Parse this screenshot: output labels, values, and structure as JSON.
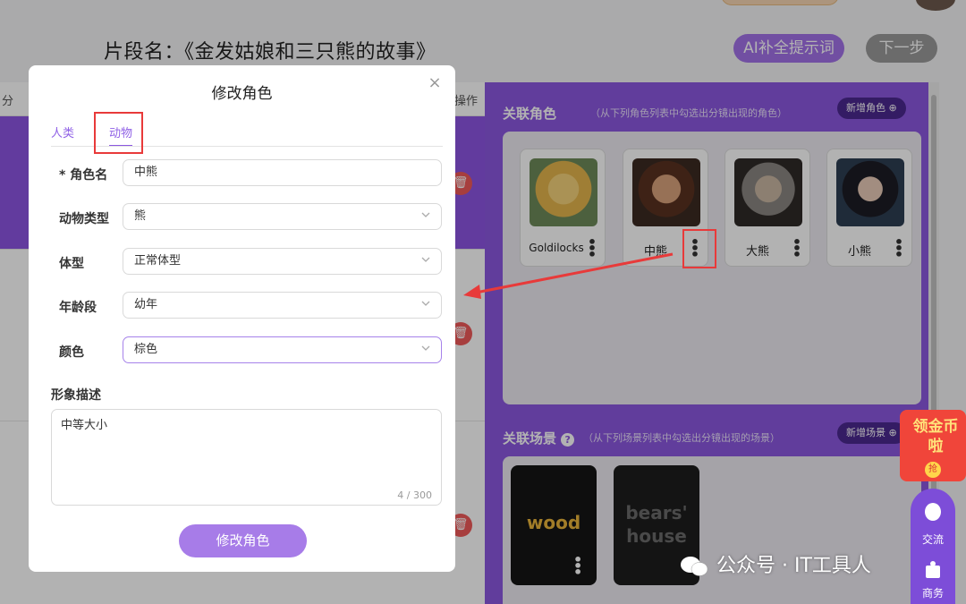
{
  "header": {
    "segment_title": "片段名：《金发姑娘和三只熊的故事》",
    "ai_button": "AI补全提示词",
    "next_button": "下一步"
  },
  "left_table": {
    "col_first_partial": "分",
    "col_op_partial": "操作"
  },
  "right_panel": {
    "characters_title": "关联角色",
    "characters_hint": "（从下列角色列表中勾选出分镜出现的角色）",
    "add_character": "新增角色 ⊕",
    "characters": [
      {
        "name": "Goldilocks",
        "art": "blonde-girl"
      },
      {
        "name": "中熊",
        "art": "bearded-man"
      },
      {
        "name": "大熊",
        "art": "old-person"
      },
      {
        "name": "小熊",
        "art": "dark-haired-girl"
      }
    ],
    "scenes_title": "关联场景",
    "scenes_hint": "（从下列场景列表中勾选出分镜出现的场景）",
    "add_scene": "新增场景 ⊕",
    "scenes": [
      {
        "label": "wood",
        "color": "#e8b33a"
      },
      {
        "label": "bears' house",
        "color": "#6a6a6a"
      }
    ]
  },
  "modal": {
    "title": "修改角色",
    "close": "×",
    "tabs": [
      "人类",
      "动物"
    ],
    "active_tab": "动物",
    "fields": [
      {
        "label": "* 角色名",
        "value": "中熊",
        "type": "text"
      },
      {
        "label": "动物类型",
        "value": "熊",
        "type": "select"
      },
      {
        "label": "体型",
        "value": "正常体型",
        "type": "select"
      },
      {
        "label": "年龄段",
        "value": "幼年",
        "type": "select"
      },
      {
        "label": "颜色",
        "value": "棕色",
        "type": "select"
      }
    ],
    "description_label": "形象描述",
    "description_value": "中等大小",
    "description_counter": "4 / 300",
    "submit": "修改角色"
  },
  "floating": {
    "coin_text": "领金币啦",
    "coin_badge": "抢",
    "chat_label": "交流",
    "business_label": "商务"
  },
  "watermark": "公众号 · IT工具人"
}
